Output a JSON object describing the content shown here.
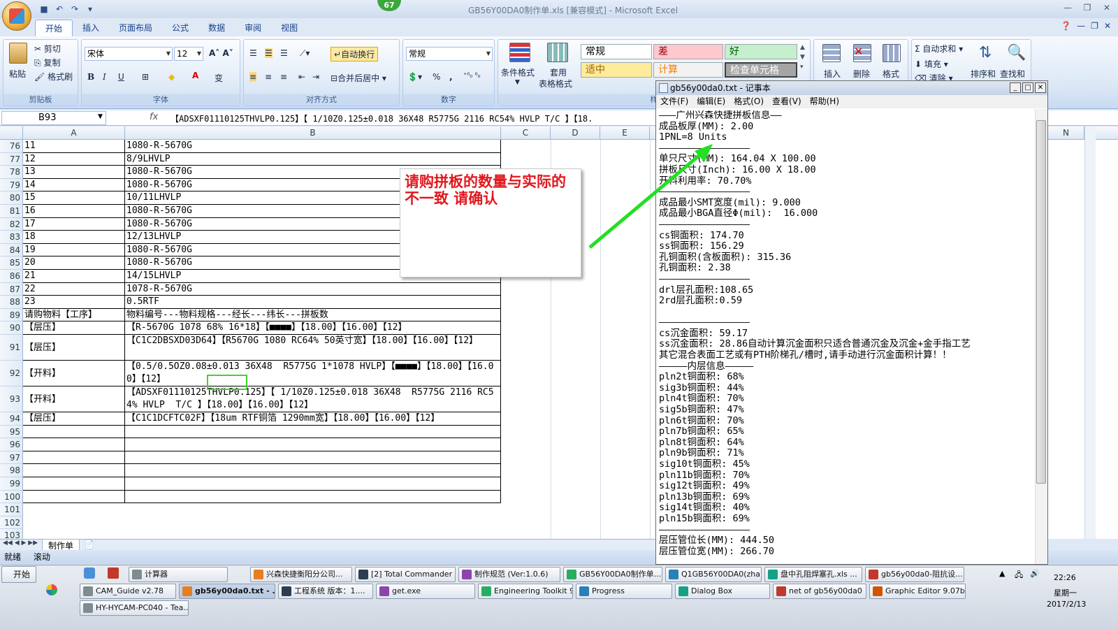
{
  "window": {
    "title": "GB56Y00DA0制作单.xls  [兼容模式] - Microsoft Excel",
    "badge": "67"
  },
  "ribbon": {
    "tabs": [
      "开始",
      "插入",
      "页面布局",
      "公式",
      "数据",
      "审阅",
      "视图"
    ],
    "clipboard": {
      "paste": "粘贴",
      "cut": "剪切",
      "copy": "复制",
      "format_painter": "格式刷",
      "label": "剪贴板"
    },
    "font": {
      "name": "宋体",
      "size": "12",
      "label": "字体"
    },
    "alignment": {
      "wrap": "自动换行",
      "merge": "合并后居中",
      "label": "对齐方式"
    },
    "number": {
      "format": "常规",
      "percent": "%",
      "comma": ",",
      "label": "数字"
    },
    "styles": {
      "conditional": "条件格式",
      "table_format_1": "套用",
      "table_format_2": "表格格式",
      "cells": [
        {
          "text": "常规",
          "bg": "#ffffff",
          "color": "#000000"
        },
        {
          "text": "差",
          "bg": "#ffc7ce",
          "color": "#9c0006"
        },
        {
          "text": "好",
          "bg": "#c6efce",
          "color": "#006100"
        },
        {
          "text": "适中",
          "bg": "#ffeb9c",
          "color": "#9c6500"
        },
        {
          "text": "计算",
          "bg": "#f2f2f2",
          "color": "#fa7d00"
        },
        {
          "text": "检查单元格",
          "bg": "#a5a5a5",
          "color": "#ffffff"
        }
      ],
      "label_partial": "样"
    },
    "cells_group": {
      "insert": "插入",
      "delete": "删除",
      "format": "格式"
    },
    "editing": {
      "autosum": "自动求和",
      "fill": "填充",
      "clear": "清除",
      "sort": "排序和",
      "find": "查找和"
    }
  },
  "formula_bar": {
    "namebox": "B93",
    "fx": "fx",
    "content": "【ADSXF01110125THVLP0.125】【 1/10Z0.125±0.018 36X48  R5775G 2116 RC54% HVLP  T/C 】【18."
  },
  "sheet": {
    "columns": [
      "A",
      "B",
      "C",
      "D",
      "E",
      "N"
    ],
    "rows": [
      {
        "num": "76",
        "a": "11",
        "b": "1080-R-5670G"
      },
      {
        "num": "77",
        "a": "12",
        "b": "8/9LHVLP"
      },
      {
        "num": "78",
        "a": "13",
        "b": "1080-R-5670G"
      },
      {
        "num": "79",
        "a": "14",
        "b": "1080-R-5670G"
      },
      {
        "num": "80",
        "a": "15",
        "b": "10/11LHVLP"
      },
      {
        "num": "81",
        "a": "16",
        "b": "1080-R-5670G"
      },
      {
        "num": "82",
        "a": "17",
        "b": "1080-R-5670G"
      },
      {
        "num": "83",
        "a": "18",
        "b": "12/13LHVLP"
      },
      {
        "num": "84",
        "a": "19",
        "b": "1080-R-5670G"
      },
      {
        "num": "85",
        "a": "20",
        "b": "1080-R-5670G"
      },
      {
        "num": "86",
        "a": "21",
        "b": "14/15LHVLP"
      },
      {
        "num": "87",
        "a": "22",
        "b": "1078-R-5670G"
      },
      {
        "num": "88",
        "a": "23",
        "b": "0.5RTF"
      },
      {
        "num": "89",
        "a": "请购物料【工序】",
        "b": "物料编号---物料规格---经长---纬长---拼板数"
      },
      {
        "num": "90",
        "a": "【层压】",
        "b": "【R-5670G 1078 68% 16*18】【■■■■】【18.00】【16.00】【12】"
      },
      {
        "num": "91",
        "a": "【层压】",
        "b": "【C1C2DBSXD03D64】【R5670G 1080 RC64% 50英寸宽】【18.00】【16.00】【12】"
      },
      {
        "num": "92",
        "a": "【开料】",
        "b": "【0.5/0.5OZ0.08±0.013 36X48  R5775G 1*1078 HVLP】【■■■■】【18.00】【16.00】【12】"
      },
      {
        "num": "93",
        "a": "【开料】",
        "b": "【ADSXF01110125THVLP0.125】【 1/10Z0.125±0.018 36X48  R5775G 2116 RC54% HVLP  T/C 】【18.00】【16.00】【12】"
      },
      {
        "num": "94",
        "a": "【层压】",
        "b": "【C1C1DCFTC02F】【18um RTF铜箔 1290mm宽】【18.00】【16.00】【12】"
      },
      {
        "num": "95",
        "a": "",
        "b": ""
      },
      {
        "num": "96",
        "a": "",
        "b": ""
      },
      {
        "num": "97",
        "a": "",
        "b": ""
      },
      {
        "num": "98",
        "a": "",
        "b": ""
      },
      {
        "num": "99",
        "a": "",
        "b": ""
      },
      {
        "num": "100",
        "a": "",
        "b": ""
      },
      {
        "num": "101",
        "a": "",
        "b": ""
      },
      {
        "num": "102",
        "a": "",
        "b": ""
      },
      {
        "num": "103",
        "a": "",
        "b": ""
      }
    ],
    "tab_name": "制作单",
    "status_ready": "就绪",
    "status_scroll": "滚动"
  },
  "callout": {
    "text": "请购拼板的数量与实际的不一致 请确认",
    "color": "#e0181e"
  },
  "notepad": {
    "title": "gb56y00da0.txt - 记事本",
    "menu": [
      "文件(F)",
      "编辑(E)",
      "格式(O)",
      "查看(V)",
      "帮助(H)"
    ],
    "lines": [
      "———广州兴森快捷拼板信息——",
      "成品板厚(MM): 2.00",
      "1PNL=8 Units",
      "————————————————",
      "单只尺寸(MM): 164.04 X 100.00",
      "拼板尺寸(Inch): 16.00 X 18.00",
      "开料利用率: 70.70%",
      "————————————————",
      "成品最小SMT宽度(mil): 9.000",
      "成品最小BGA直径Φ(mil):  16.000",
      "————————————————",
      "cs铜面积: 174.70",
      "ss铜面积: 156.29",
      "孔铜面积(含板面积): 315.36",
      "孔铜面积: 2.38",
      "————————————————",
      "drl层孔面积:108.65",
      "2rd层孔面积:0.59",
      "",
      "————————————————",
      "cs沉金面积: 59.17",
      "ss沉金面积: 28.86自动计算沉金面积只适合普通沉金及沉金+金手指工艺",
      "其它混合表面工艺或有PTH阶梯孔/槽时,请手动进行沉金面积计算！！",
      "—————内层信息—————",
      "pln2t铜面积: 68%",
      "sig3b铜面积: 44%",
      "pln4t铜面积: 70%",
      "sig5b铜面积: 47%",
      "pln6t铜面积: 70%",
      "pln7b铜面积: 65%",
      "pln8t铜面积: 64%",
      "pln9b铜面积: 71%",
      "sig10t铜面积: 45%",
      "pln11b铜面积: 70%",
      "sig12t铜面积: 49%",
      "pln13b铜面积: 69%",
      "sig14t铜面积: 40%",
      "pln15b铜面积: 69%",
      "————————————————",
      "层压管位长(MM): 444.50",
      "层压管位宽(MM): 266.70"
    ]
  },
  "taskbar": {
    "start": "开始",
    "row1": [
      "计算器",
      "兴森快捷衡阳分公司...",
      "[2] Total Commander ...",
      "制作规范 (Ver:1.0.6)",
      "GB56Y00DA0制作单....",
      "Q1GB56Y00DA0(zhan...",
      "盘中孔阻焊塞孔.xls ...",
      "gb56y00da0-阻抗设..."
    ],
    "row2": [
      "CAM_Guide v2.78",
      "gb56y00da0.txt - ...",
      "工程系统  版本：1....",
      "get.exe",
      "Engineering Toolkit 9....",
      "Progress",
      "Dialog Box",
      "net of gb56y00da0",
      "Graphic Editor 9.07b..."
    ],
    "row3": [
      "HY-HYCAM-PC040 - Tea..."
    ],
    "clock": "22:26",
    "weekday": "星期一",
    "date": "2017/2/13"
  }
}
